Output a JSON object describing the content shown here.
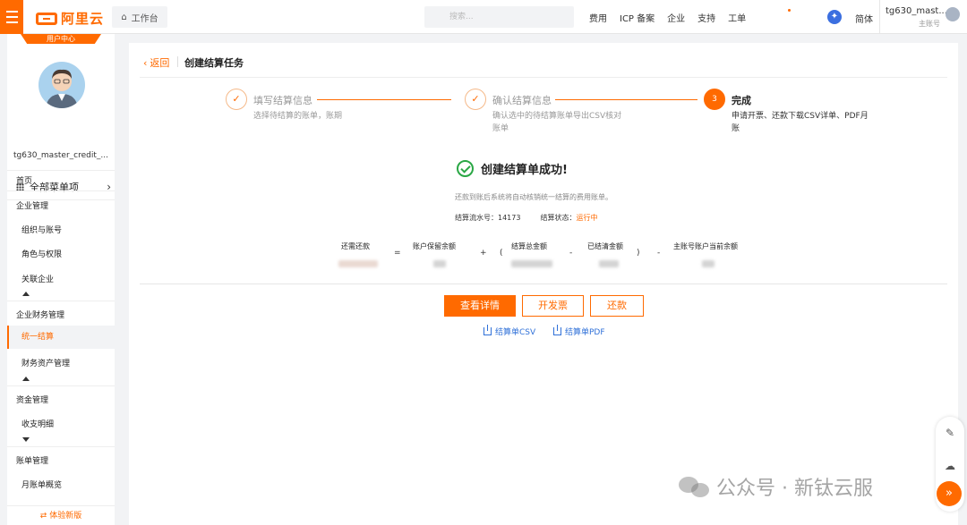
{
  "topbar": {
    "logo_text": "阿里云",
    "workbench_label": "工作台",
    "search_placeholder": "搜索...",
    "nav": [
      "费用",
      "ICP 备案",
      "企业",
      "支持",
      "工单"
    ],
    "lang": "简体",
    "user_name": "tg630_mast...",
    "user_role": "主账号"
  },
  "sidebar": {
    "tab_label": "用户中心",
    "user_name": "tg630_master_credit_...",
    "all_menu": "全部菜单项",
    "items": {
      "home": "首页",
      "ent_mgmt": "企业管理",
      "org_account": "组织与账号",
      "role_perm": "角色与权限",
      "related_ent": "关联企业",
      "ent_finance": "企业财务管理",
      "unified_settle": "统一结算",
      "fin_asset": "财务资产管理",
      "fund_mgmt": "资金管理",
      "income_detail": "收支明细",
      "bill_mgmt": "账单管理",
      "monthly_bill": "月账单概览"
    },
    "bottom_link": "⇄ 体验新版"
  },
  "main": {
    "back_label": "返回",
    "page_title": "创建结算任务",
    "steps": [
      {
        "title": "填写结算信息",
        "desc": "选择待结算的账单，账期",
        "marker": "✓"
      },
      {
        "title": "确认结算信息",
        "desc": "确认选中的待结算账单导出CSV核对账单",
        "marker": "✓"
      },
      {
        "title": "完成",
        "desc": "申请开票、还款下载CSV详单、PDF月账",
        "marker": "3"
      }
    ],
    "success_title": "创建结算单成功!",
    "success_desc": "还款到账后系统将自动核销统一结算的费用账单。",
    "serial_label": "结算流水号：",
    "serial_value": "14173",
    "status_label": "结算状态：",
    "status_value": "运行中",
    "formula": {
      "need_repay": "还需还款",
      "reserve_balance": "账户保留余额",
      "settle_total": "结算总金额",
      "settled_amount": "已结清金额",
      "main_balance": "主账号账户当前余额",
      "op_eq": "=",
      "op_plus": "+",
      "op_lparen": "(",
      "op_minus1": "-",
      "op_rparen": ")",
      "op_minus2": "-"
    },
    "buttons": {
      "view_detail": "查看详情",
      "invoice": "开发票",
      "repay": "还款"
    },
    "links": {
      "csv": "结算单CSV",
      "pdf": "结算单PDF"
    }
  },
  "watermark": "公众号 · 新钛云服",
  "colors": {
    "brand": "#ff6a00",
    "success": "#2aa745",
    "link": "#2f70d8"
  }
}
